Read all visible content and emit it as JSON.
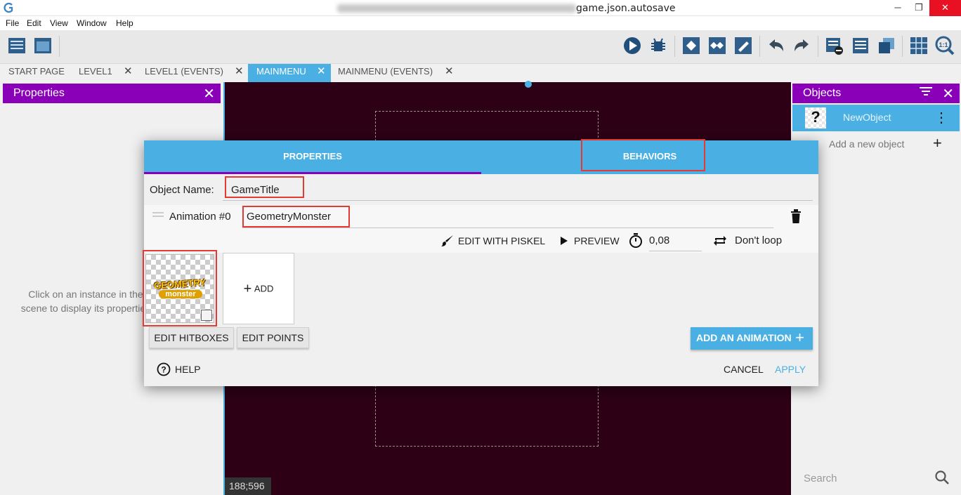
{
  "window": {
    "title": "game.json.autosave",
    "minimize": "─",
    "maximize": "❐",
    "close": "✕"
  },
  "menu": [
    "File",
    "Edit",
    "View",
    "Window",
    "Help"
  ],
  "tabs": [
    {
      "label": "START PAGE",
      "closable": false
    },
    {
      "label": "LEVEL1",
      "closable": true
    },
    {
      "label": "LEVEL1 (EVENTS)",
      "closable": true
    },
    {
      "label": "MAINMENU",
      "closable": true,
      "active": true
    },
    {
      "label": "MAINMENU (EVENTS)",
      "closable": true
    }
  ],
  "properties_panel": {
    "title": "Properties",
    "hint": "Click on an instance in the scene to display its properties"
  },
  "canvas": {
    "coords": "188;596"
  },
  "objects_panel": {
    "title": "Objects",
    "item_name": "NewObject",
    "item_thumb": "?",
    "add_label": "Add a new object",
    "search_placeholder": "Search"
  },
  "dialog": {
    "tab_properties": "PROPERTIES",
    "tab_behaviors": "BEHAVIORS",
    "object_name_label": "Object Name:",
    "object_name_value": "GameTitle",
    "animation_label": "Animation #0",
    "animation_name": "GeometryMonster",
    "edit_piskel": "EDIT WITH PISKEL",
    "preview": "PREVIEW",
    "frame_time": "0,08",
    "loop": "Don't loop",
    "add_frame": "ADD",
    "sprite_text_top": "GEOMETRY",
    "sprite_text_bottom": "monster",
    "edit_hitboxes": "EDIT HITBOXES",
    "edit_points": "EDIT POINTS",
    "add_animation": "ADD AN ANIMATION",
    "help": "HELP",
    "cancel": "CANCEL",
    "apply": "APPLY"
  },
  "colors": {
    "accent": "#4ab0e4",
    "panel_header": "#8a00b8",
    "canvas_bg": "#2d0016",
    "highlight": "#e53935"
  }
}
